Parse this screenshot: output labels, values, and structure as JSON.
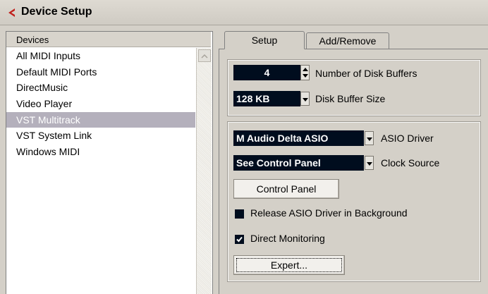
{
  "window": {
    "title": "Device Setup"
  },
  "devices": {
    "header": "Devices",
    "items": [
      {
        "label": "All MIDI Inputs"
      },
      {
        "label": "Default MIDI Ports"
      },
      {
        "label": "DirectMusic"
      },
      {
        "label": "Video Player"
      },
      {
        "label": "VST Multitrack",
        "selected": true
      },
      {
        "label": "VST System Link"
      },
      {
        "label": "Windows MIDI"
      }
    ]
  },
  "tabs": [
    {
      "label": "Setup",
      "active": true
    },
    {
      "label": "Add/Remove",
      "active": false
    }
  ],
  "setup": {
    "disk_buffers": {
      "value": "4",
      "label": "Number of Disk Buffers"
    },
    "buffer_size": {
      "value": "128 KB",
      "label": "Disk Buffer Size"
    },
    "asio_driver": {
      "value": "M Audio Delta ASIO",
      "label": "ASIO Driver"
    },
    "clock_source": {
      "value": "See Control Panel",
      "label": "Clock Source"
    },
    "control_panel_button": "Control Panel",
    "release_asio": {
      "label": "Release ASIO Driver in Background",
      "checked": false
    },
    "direct_monitoring": {
      "label": "Direct Monitoring",
      "checked": true
    },
    "expert_button": "Expert..."
  },
  "colors": {
    "selection": "#b4b0bc",
    "field_bg": "#000d1e",
    "window_bg": "#d4d0c8",
    "logo": "#c0201c"
  },
  "icons": {
    "logo": "cubase-logo-icon",
    "scroll_up": "scroll-up-arrow-icon",
    "spin": "spin-arrows-icon",
    "dropdown": "dropdown-arrow-icon",
    "check": "checkmark-icon"
  }
}
